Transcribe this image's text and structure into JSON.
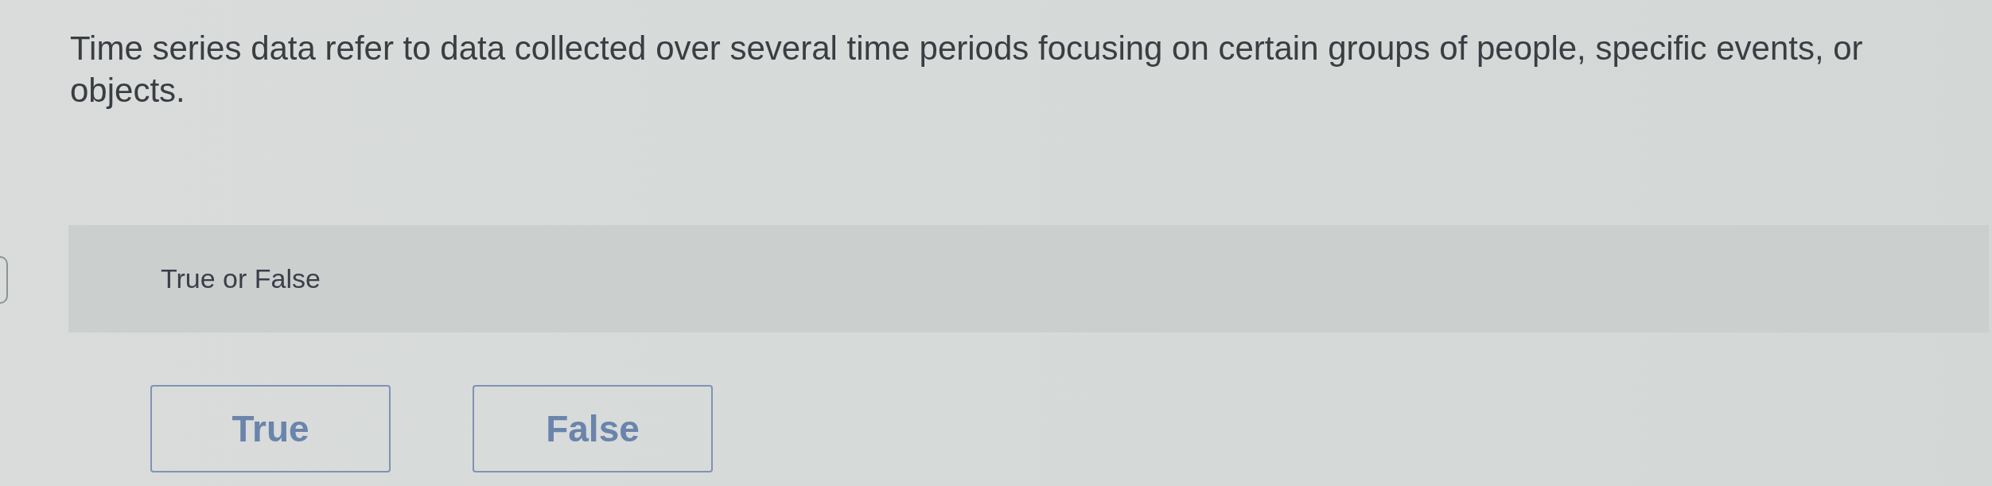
{
  "question": {
    "text": "Time series data refer to data collected over several time periods focusing on certain groups of people, specific events, or objects."
  },
  "answer_panel": {
    "label": "True or False"
  },
  "options": [
    {
      "label": "True",
      "selected": false
    },
    {
      "label": "False",
      "selected": false
    }
  ]
}
